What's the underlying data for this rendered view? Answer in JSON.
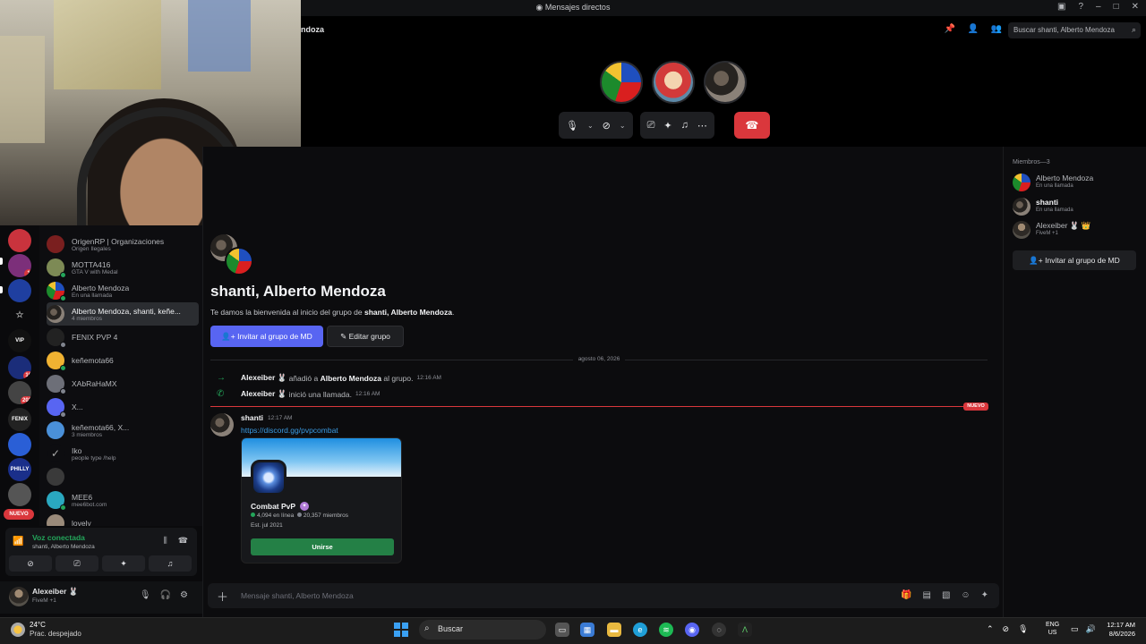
{
  "window": {
    "title": "Mensajes directos"
  },
  "header": {
    "name": "ndoza",
    "search_placeholder": "Buscar shanti, Alberto Mendoza"
  },
  "call": {
    "controls": [
      "mic-icon",
      "camera-off-icon",
      "screen-share-icon",
      "activities-icon",
      "soundboard-icon",
      "more-icon"
    ],
    "end_call_icon": "phone-hangup-icon"
  },
  "dm_list": [
    {
      "name": "OrigenRP | Organizaciones",
      "sub": "Origen Ilegales"
    },
    {
      "name": "MOTTA416",
      "sub": "GTA V with Medal"
    },
    {
      "name": "Alberto Mendoza",
      "sub": "En una llamada"
    },
    {
      "name": "Alberto Mendoza, shanti, keñe...",
      "sub": "4 miembros"
    },
    {
      "name": "FENIX PVP 4",
      "sub": ""
    },
    {
      "name": "keñemota66",
      "sub": ""
    },
    {
      "name": "XAbRaHaMX",
      "sub": ""
    },
    {
      "name": "X...",
      "sub": ""
    },
    {
      "name": "keñemota66, X...",
      "sub": "3 miembros"
    },
    {
      "name": "Iko",
      "sub": "people type /help"
    },
    {
      "name": "",
      "sub": ""
    },
    {
      "name": "MEE6",
      "sub": "mee6bot.com"
    },
    {
      "name": "lovely",
      "sub": ""
    }
  ],
  "servers": {
    "badges": [
      "1",
      "16",
      "202",
      "1"
    ],
    "labels": [
      "",
      "",
      "VIP",
      "",
      "FENIX",
      "",
      "PHILLY RP",
      ""
    ],
    "nuevo": "NUEVO"
  },
  "voice": {
    "title": "Voz conectada",
    "channel": "shanti, Alberto Mendoza"
  },
  "user": {
    "name": "Alexeiber 🐰",
    "status": "FiveM +1"
  },
  "chat": {
    "title": "shanti, Alberto Mendoza",
    "welcome_prefix": "Te damos la bienvenida al inicio del grupo de ",
    "welcome_names": "shanti, Alberto Mendoza",
    "welcome_suffix": ".",
    "invite_btn": "Invitar al grupo de MD",
    "edit_btn": "Editar grupo",
    "date": "agosto 06, 2026",
    "sys1": {
      "actor": "Alexeiber 🐰",
      "verb": " añadió a ",
      "target": "Alberto Mendoza",
      "rest": " al grupo.",
      "time": "12:16 AM"
    },
    "sys2": {
      "actor": "Alexeiber 🐰",
      "verb": " inició una llamada.",
      "time": "12:16 AM"
    },
    "new_badge": "NUEVO",
    "message": {
      "author": "shanti",
      "time": "12:17 AM",
      "link": "https://discord.gg/pvpcombat"
    },
    "invite_card": {
      "name": "Combat PvP",
      "online": "4,094 en línea",
      "members": "20,357 miembros",
      "est": "Est. jul 2021",
      "join": "Unirse"
    },
    "composer_placeholder": "Mensaje shanti, Alberto Mendoza"
  },
  "members": {
    "header": "Miembros—3",
    "list": [
      {
        "name": "Alberto Mendoza",
        "sub": "En una llamada"
      },
      {
        "name": "shanti",
        "sub": "En una llamada"
      },
      {
        "name": "Alexeiber 🐰 👑",
        "sub": "FiveM +1"
      }
    ],
    "invite_btn": "Invitar al grupo de MD"
  },
  "taskbar": {
    "temp": "24°C",
    "condition": "Prac. despejado",
    "search": "Buscar",
    "lang1": "ENG",
    "lang2": "US",
    "time": "12:17 AM",
    "date": "8/6/2026"
  },
  "colors": {
    "accent": "#5865f2",
    "danger": "#da373c",
    "online": "#23a55a",
    "link": "#3a9be3",
    "join": "#248046"
  }
}
